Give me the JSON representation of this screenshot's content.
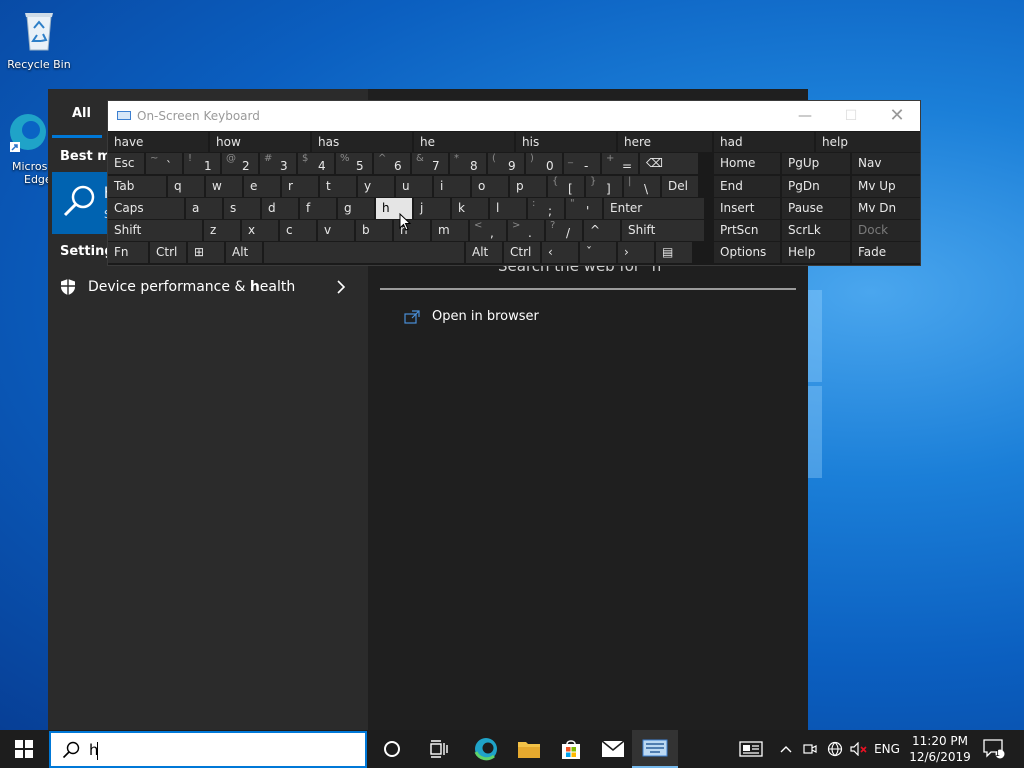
{
  "desktop": {
    "icons": [
      {
        "label": "Recycle Bin"
      },
      {
        "label": "Micros",
        "label2": "Edge"
      }
    ]
  },
  "start_panel": {
    "tab_all": "All",
    "best_match_label": "Best ma",
    "best_match_trunc1": "h",
    "best_match_trunc2": "S",
    "settings_label": "Settings",
    "settings_result": {
      "pre": "Device performance & ",
      "bold": "h",
      "post": "ealth"
    },
    "search_web": "Search the web for \"h\"",
    "open_in_browser": "Open in browser"
  },
  "osk": {
    "title": "On-Screen Keyboard",
    "suggestions": [
      "have",
      "how",
      "has",
      "he",
      "his",
      "here",
      "had",
      "help"
    ],
    "row1": [
      "Esc",
      "~ `",
      "! 1",
      "@ 2",
      "# 3",
      "$ 4",
      "% 5",
      "^ 6",
      "& 7",
      "* 8",
      "( 9",
      ") 0",
      "_ -",
      "+ =",
      "⌫"
    ],
    "row2": [
      "Tab",
      "q",
      "w",
      "e",
      "r",
      "t",
      "y",
      "u",
      "i",
      "o",
      "p",
      "{ [",
      "} ]",
      "| \\",
      "Del"
    ],
    "row3": [
      "Caps",
      "a",
      "s",
      "d",
      "f",
      "g",
      "h",
      "j",
      "k",
      "l",
      ": ;",
      "\" '",
      "Enter"
    ],
    "row4": [
      "Shift",
      "z",
      "x",
      "c",
      "v",
      "b",
      "n",
      "m",
      "< ,",
      "> .",
      "? /",
      "^",
      "Shift"
    ],
    "row5": [
      "Fn",
      "Ctrl",
      "⊞",
      "Alt",
      "",
      "Alt",
      "Ctrl",
      "‹",
      "ˇ",
      "›",
      "▤"
    ],
    "nav_keys": [
      [
        "Home",
        "PgUp",
        "Nav"
      ],
      [
        "End",
        "PgDn",
        "Mv Up"
      ],
      [
        "Insert",
        "Pause",
        "Mv Dn"
      ],
      [
        "PrtScn",
        "ScrLk",
        "Dock"
      ],
      [
        "Options",
        "Help",
        "Fade"
      ]
    ],
    "highlighted_key": "h"
  },
  "taskbar": {
    "search_value": "h",
    "lang": "ENG",
    "time": "11:20 PM",
    "date": "12/6/2019",
    "notification_count": "1"
  },
  "colors": {
    "accent": "#0078d7",
    "panel_dark": "#1f1f1f",
    "taskbar": "#1d1d1d"
  }
}
